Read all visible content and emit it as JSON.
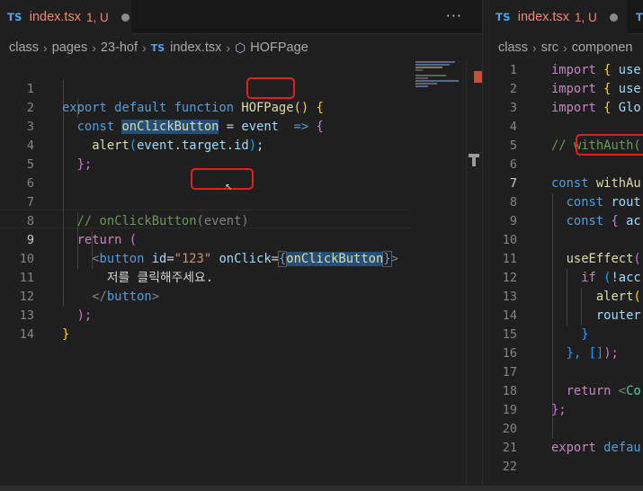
{
  "left": {
    "tab": {
      "icon": "TS",
      "name": "index.tsx",
      "status": "1, U"
    },
    "more": "···",
    "breadcrumb": {
      "a": "class",
      "b": "pages",
      "c": "23-hof",
      "ts": "TS",
      "file": "index.tsx",
      "sym": "HOFPage"
    },
    "lines": [
      "1",
      "2",
      "3",
      "4",
      "5",
      "6",
      "7",
      "8",
      "9",
      "10",
      "11",
      "12",
      "13",
      "14"
    ],
    "code": {
      "l1a": "export",
      "l1b": "default",
      "l1c": "function",
      "l1d": "HOFPage",
      "l1e": "()",
      "l1f": "{",
      "l2a": "const",
      "l2b": "onClickButton",
      "l2c": "=",
      "l2d": "event",
      "l2e": "=>",
      "l2f": "{",
      "l3a": "alert",
      "l3b": "(",
      "l3c": "event",
      "l3d": ".",
      "l3e": "target",
      "l3f": ".",
      "l3g": "id",
      "l3h": ")",
      "l3i": ";",
      "l4a": "};",
      "l7a": "// onClickButton",
      "l7b": "(event)",
      "l8a": "return",
      "l8b": "(",
      "l9a": "<",
      "l9b": "button",
      "l9c": "id",
      "l9d": "=",
      "l9e": "\"123\"",
      "l9f": "onClick",
      "l9g": "=",
      "l9h": "{",
      "l9i": "onClickButton",
      "l9j": "}",
      "l9k": ">",
      "l10a": "저를 클릭해주세요.",
      "l11a": "</",
      "l11b": "button",
      "l11c": ">",
      "l12a": ");",
      "l13a": "}"
    }
  },
  "right": {
    "tab": {
      "icon": "TS",
      "name": "index.tsx",
      "status": "1, U",
      "next_icon": "T"
    },
    "breadcrumb": {
      "a": "class",
      "b": "src",
      "c": "componen"
    },
    "lines": [
      "1",
      "2",
      "3",
      "4",
      "5",
      "6",
      "7",
      "8",
      "9",
      "10",
      "11",
      "12",
      "13",
      "14",
      "15",
      "16",
      "17",
      "18",
      "19",
      "20",
      "21",
      "22"
    ],
    "code": {
      "l1a": "import",
      "l1b": "{",
      "l1c": "use",
      "l2a": "import",
      "l2b": "{",
      "l2c": "use",
      "l3a": "import",
      "l3b": "{",
      "l3c": "Glo",
      "l5a": "//",
      "l5b": "withAuth(",
      "l7a": "const",
      "l7b": "withAu",
      "l8a": "const",
      "l8b": "rout",
      "l9a": "const",
      "l9b": "{",
      "l9c": "ac",
      "l11a": "useEffect",
      "l11b": "(",
      "l12a": "if",
      "l12b": "(",
      "l12c": "!acc",
      "l13a": "alert",
      "l13b": "(",
      "l14a": "router",
      "l15a": "}",
      "l16a": "},",
      "l16b": "[]",
      "l16c": ");",
      "l18a": "return",
      "l18b": "<",
      "l18c": "Co",
      "l19a": "};",
      "l21a": "export",
      "l21b": "defau"
    }
  }
}
